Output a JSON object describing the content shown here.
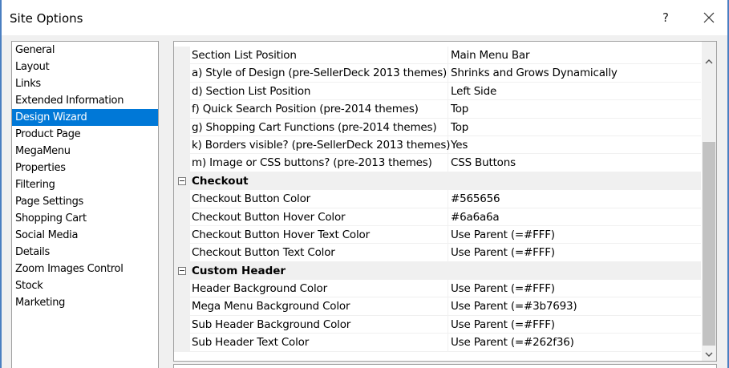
{
  "window": {
    "title": "Site Options",
    "help_label": "?"
  },
  "nav": {
    "items": [
      "General",
      "Layout",
      "Links",
      "Extended Information",
      "Design Wizard",
      "Product Page",
      "MegaMenu",
      "Properties",
      "Filtering",
      "Page Settings",
      "Shopping Cart",
      "Social Media",
      "Details",
      "Zoom Images Control",
      "Stock",
      "Marketing"
    ],
    "selected": "Design Wizard"
  },
  "grid": {
    "rows": [
      {
        "name": "Section List Position",
        "value": "Main Menu Bar"
      },
      {
        "name": "a) Style of Design (pre-SellerDeck 2013 themes)",
        "value": "Shrinks and Grows Dynamically"
      },
      {
        "name": "d) Section List Position",
        "value": "Left Side"
      },
      {
        "name": "f) Quick Search Position (pre-2014 themes)",
        "value": "Top"
      },
      {
        "name": "g) Shopping Cart Functions (pre-2014 themes)",
        "value": "Top"
      },
      {
        "name": "k) Borders visible? (pre-SellerDeck 2013 themes)",
        "value": "Yes"
      },
      {
        "name": "m) Image or CSS buttons? (pre-2013 themes)",
        "value": "CSS Buttons"
      }
    ],
    "checkout": {
      "label": "Checkout",
      "rows": [
        {
          "name": "Checkout Button Color",
          "value": "#565656"
        },
        {
          "name": "Checkout Button Hover Color",
          "value": "#6a6a6a"
        },
        {
          "name": "Checkout Button Hover Text Color",
          "value": "Use Parent (=#FFF)"
        },
        {
          "name": "Checkout Button Text Color",
          "value": "Use Parent (=#FFF)"
        }
      ]
    },
    "custom_header": {
      "label": "Custom Header",
      "rows": [
        {
          "name": "Header Background Color",
          "value": "Use Parent (=#FFF)"
        },
        {
          "name": "Mega Menu Background Color",
          "value": "Use Parent (=#3b7693)"
        },
        {
          "name": "Sub Header Background Color",
          "value": "Use Parent (=#FFF)"
        },
        {
          "name": "Sub Header Text Color",
          "value": "Use Parent (=#262f36)"
        }
      ]
    }
  },
  "colors": {
    "selection": "#0078d7",
    "window_border": "#4a7fc1",
    "panel_bg": "#f0f0f0"
  }
}
